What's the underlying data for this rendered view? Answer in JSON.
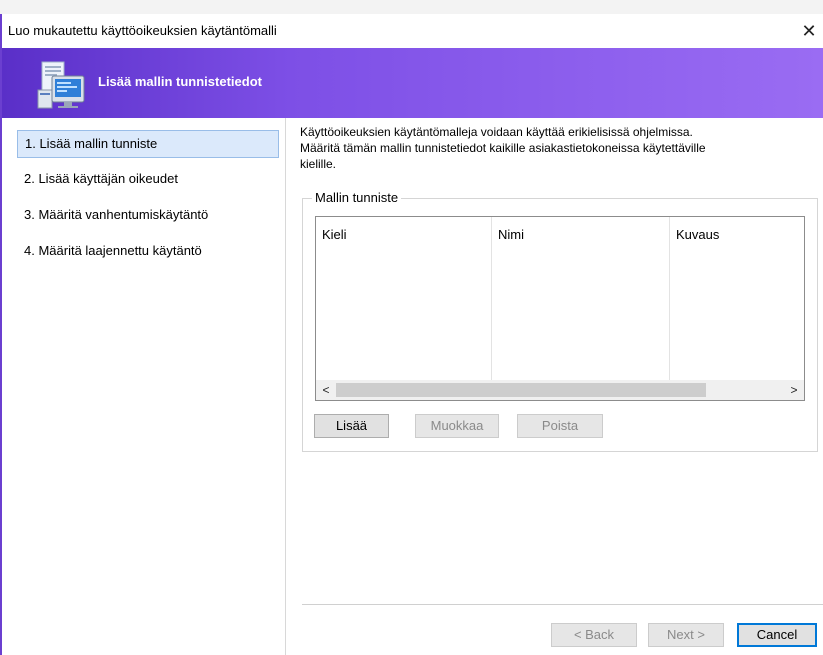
{
  "window": {
    "title": "Luo mukautettu käyttöoikeuksien käytäntömalli",
    "close_label": "✕"
  },
  "banner": {
    "title": "Lisää mallin tunnistetiedot",
    "icon": "computer-document-icon",
    "colors": {
      "start": "#5a2fc8",
      "end": "#9a6cf3"
    }
  },
  "steps": [
    {
      "label": "1. Lisää mallin tunniste",
      "active": true
    },
    {
      "label": "2. Lisää käyttäjän oikeudet",
      "active": false
    },
    {
      "label": "3. Määritä vanhentumiskäytäntö",
      "active": false
    },
    {
      "label": "4. Määritä laajennettu käytäntö",
      "active": false
    }
  ],
  "content": {
    "intro_line1": "Käyttöoikeuksien käytäntömalleja voidaan käyttää erikielisissä ohjelmissa.",
    "intro_line2": "Määritä tämän mallin tunnistetiedot kaikille asiakastietokoneissa käytettäville",
    "intro_line3": "kielille.",
    "group_title": "Mallin tunniste",
    "columns": [
      "Kieli",
      "Nimi",
      "Kuvaus"
    ],
    "rows": [],
    "scroll_left": "<",
    "scroll_right": ">",
    "buttons": {
      "add": "Lisää",
      "edit": "Muokkaa",
      "remove": "Poista"
    }
  },
  "footer": {
    "back": "< Back",
    "next": "Next >",
    "cancel": "Cancel"
  }
}
